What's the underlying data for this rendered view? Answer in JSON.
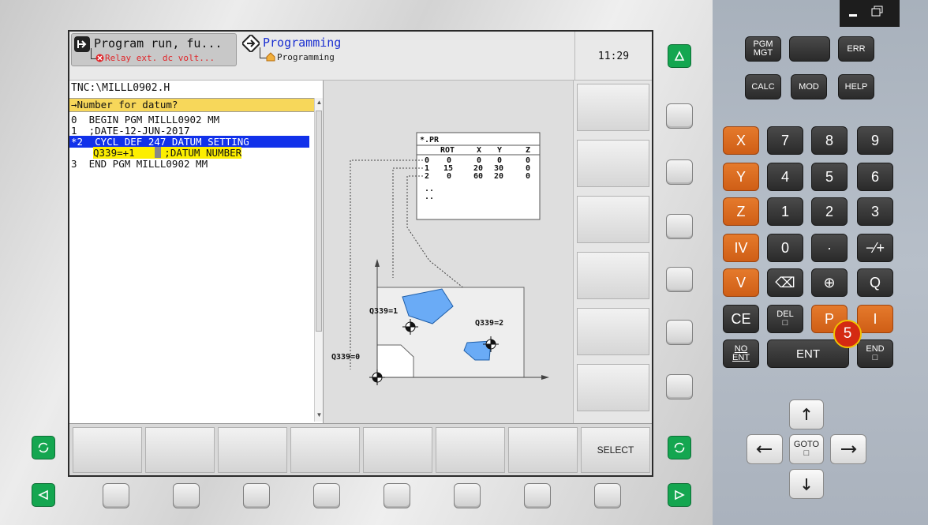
{
  "header": {
    "mode1": {
      "title": "Program run, fu...",
      "sub": "Relay ext. dc volt..."
    },
    "mode2": {
      "title": "Programming",
      "sub": "Programming"
    },
    "clock": "11:29"
  },
  "program": {
    "path": "TNC:\\MILLL0902.H",
    "prompt": "→Number for datum?",
    "lines": [
      "0  BEGIN PGM MILLL0902 MM",
      "1  ;DATE-12-JUN-2017",
      "*2  CYCL DEF 247 DATUM SETTING",
      "Q339=+1     ;DATUM NUMBER",
      "3  END PGM MILLL0902 MM"
    ]
  },
  "graphic": {
    "table_title": "*.PR",
    "table_headers": [
      "ROT",
      "X",
      "Y",
      "Z"
    ],
    "table_rows": [
      [
        "0",
        "0",
        "0",
        "0",
        "0"
      ],
      [
        "1",
        "15",
        "20",
        "30",
        "0"
      ],
      [
        "2",
        "0",
        "60",
        "20",
        "0"
      ]
    ],
    "ellipsis": [
      "..",
      ".."
    ],
    "labels": {
      "q1": "Q339=1",
      "q2": "Q339=2",
      "q0": "Q339=0"
    }
  },
  "softkeys": {
    "horizontal": [
      "",
      "",
      "",
      "",
      "",
      "",
      "",
      "SELECT"
    ]
  },
  "keyboard": {
    "row1": [
      "PGM\nMGT",
      "",
      "ERR"
    ],
    "row2": [
      "CALC",
      "MOD",
      "HELP"
    ],
    "axes": [
      "X",
      "Y",
      "Z",
      "IV",
      "V"
    ],
    "digits": [
      [
        "7",
        "8",
        "9"
      ],
      [
        "4",
        "5",
        "6"
      ],
      [
        "1",
        "2",
        "3"
      ],
      [
        "0",
        "·",
        "−⁄+"
      ]
    ],
    "row_v": [
      "⌫",
      "⊕",
      "Q"
    ],
    "row_ce": [
      "CE",
      "DEL\n□",
      "P",
      "I"
    ],
    "row_ent": [
      "NO\nENT",
      "ENT",
      "END\n□"
    ],
    "goto": "GOTO\n□",
    "badge": "5"
  },
  "colors": {
    "accent_blue": "#1131ea",
    "highlight_yellow": "#fcee00",
    "prompt_yellow": "#f7d75a",
    "orange_key": "#d9661f",
    "green_key": "#14a650"
  }
}
